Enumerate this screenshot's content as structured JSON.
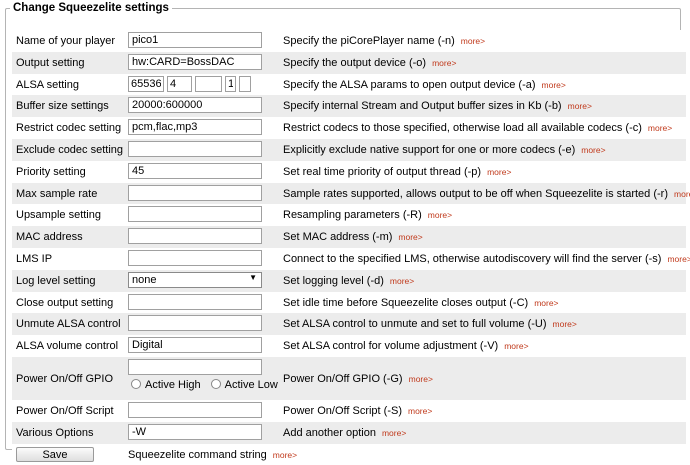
{
  "panel": {
    "legend": "Change Squeezelite settings"
  },
  "more_label": "more>",
  "rows": [
    {
      "label": "Name of your player",
      "value": "pico1",
      "desc": "Specify the piCorePlayer name (-n)"
    },
    {
      "label": "Output setting",
      "value": "hw:CARD=BossDAC",
      "desc": "Specify the output device (-o)"
    },
    {
      "label": "ALSA setting",
      "alsa": [
        "65536",
        "4",
        "",
        "1",
        ""
      ],
      "desc": "Specify the ALSA params to open output device (-a)"
    },
    {
      "label": "Buffer size settings",
      "value": "20000:600000",
      "desc": "Specify internal Stream and Output buffer sizes in Kb (-b)"
    },
    {
      "label": "Restrict codec setting",
      "value": "pcm,flac,mp3",
      "desc": "Restrict codecs to those specified, otherwise load all available codecs (-c)"
    },
    {
      "label": "Exclude codec setting",
      "value": "",
      "desc": "Explicitly exclude native support for one or more codecs (-e)"
    },
    {
      "label": "Priority setting",
      "value": "45",
      "desc": "Set real time priority of output thread (-p)"
    },
    {
      "label": "Max sample rate",
      "value": "",
      "desc": "Sample rates supported, allows output to be off when Squeezelite is started (-r)"
    },
    {
      "label": "Upsample setting",
      "value": "",
      "desc": "Resampling parameters (-R)"
    },
    {
      "label": "MAC address",
      "value": "",
      "desc": "Set MAC address (-m)"
    },
    {
      "label": "LMS IP",
      "value": "",
      "desc": "Connect to the specified LMS, otherwise autodiscovery will find the server (-s)"
    },
    {
      "label": "Log level setting",
      "select": "none",
      "desc": "Set logging level (-d)"
    },
    {
      "label": "Close output setting",
      "value": "",
      "desc": "Set idle time before Squeezelite closes output (-C)"
    },
    {
      "label": "Unmute ALSA control",
      "value": "",
      "desc": "Set ALSA control to unmute and set to full volume (-U)"
    },
    {
      "label": "ALSA volume control",
      "value": "Digital",
      "desc": "Set ALSA control for volume adjustment (-V)"
    },
    {
      "label": "Power On/Off GPIO",
      "value": "",
      "radios": [
        "Active High",
        "Active Low"
      ],
      "desc": "Power On/Off GPIO (-G)"
    },
    {
      "label": "Power On/Off Script",
      "value": "",
      "desc": "Power On/Off Script (-S)"
    },
    {
      "label": "Various Options",
      "value": "-W",
      "desc": "Add another option"
    }
  ],
  "footer": {
    "save_label": "Save",
    "cmd_label": "Squeezelite command string"
  }
}
